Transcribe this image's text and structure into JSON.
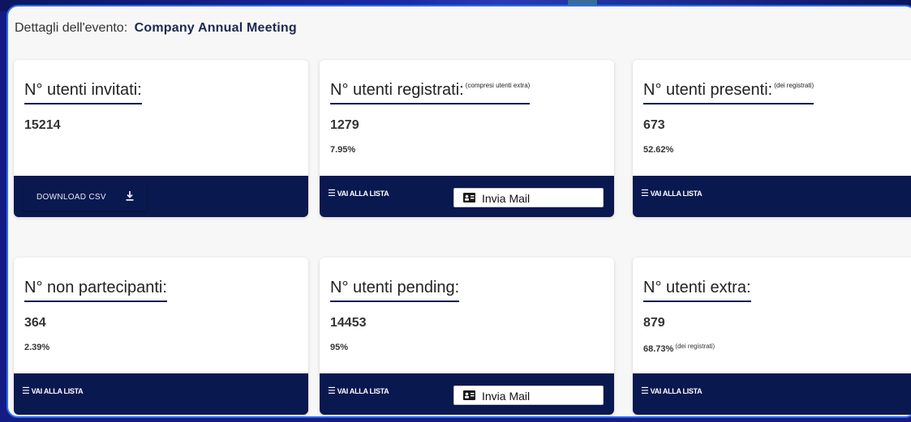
{
  "event": {
    "label": "Dettagli dell'evento:",
    "name": "Company Annual Meeting"
  },
  "cards": {
    "invitati": {
      "title": "N° utenti invitati:",
      "value": "15214",
      "download_label": "DOWNLOAD CSV",
      "download_icon": "download-icon"
    },
    "registrati": {
      "title": "N° utenti registrati:",
      "title_note": "(compresi utenti extra)",
      "value": "1279",
      "percent": "7.95%",
      "link_label": "VAI ALLA LISTA",
      "mail_label": "Invia Mail",
      "mail_icon": "contact-card-icon"
    },
    "presenti": {
      "title": "N° utenti presenti:",
      "title_note": "(dei registrati)",
      "value": "673",
      "percent": "52.62%",
      "link_label": "VAI ALLA LISTA"
    },
    "non_partecipanti": {
      "title": "N° non partecipanti:",
      "value": "364",
      "percent": "2.39%",
      "link_label": "VAI ALLA LISTA"
    },
    "pending": {
      "title": "N° utenti pending:",
      "value": "14453",
      "percent": "95%",
      "link_label": "VAI ALLA LISTA",
      "mail_label": "Invia Mail",
      "mail_icon": "contact-card-icon"
    },
    "extra": {
      "title": "N° utenti extra:",
      "value": "879",
      "percent": "68.73%",
      "percent_note": "(dei registrati)",
      "link_label": "VAI ALLA LISTA"
    }
  },
  "icons": {
    "list": "hamburger-menu-icon",
    "list_glyph": "☰"
  },
  "colors": {
    "footer": "#0a1850",
    "title_underline": "#0d1b4c",
    "event_name": "#1c2a4f",
    "page_background": "#141c84",
    "panel_border": "#2d6df0"
  }
}
